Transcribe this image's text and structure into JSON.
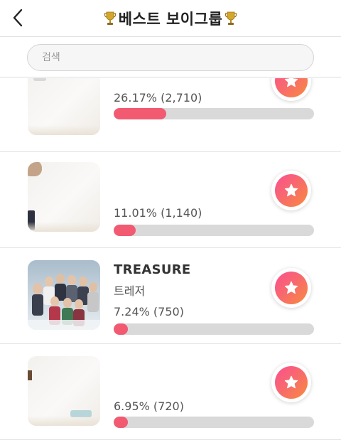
{
  "header": {
    "title": "베스트 보이그룹",
    "back_icon": "chevron-left-icon",
    "trophy_icon": "trophy-icon",
    "trophy_color": "#c89a1f"
  },
  "search": {
    "placeholder": "검색",
    "value": ""
  },
  "theme": {
    "bar_fill": "#f15a71",
    "bar_track": "#d9d9d9",
    "vote_gradient": [
      "#fb4f8f",
      "#f98b3c"
    ]
  },
  "items": [
    {
      "name": "",
      "sub": "",
      "percent_label": "26.17% (2,710)",
      "percent": 26.17,
      "votes": 2710,
      "vote_icon": "star-icon"
    },
    {
      "name": "",
      "sub": "",
      "percent_label": "11.01% (1,140)",
      "percent": 11.01,
      "votes": 1140,
      "vote_icon": "star-icon"
    },
    {
      "name": "TREASURE",
      "sub": "트레저",
      "percent_label": "7.24% (750)",
      "percent": 7.24,
      "votes": 750,
      "vote_icon": "star-icon"
    },
    {
      "name": "",
      "sub": "",
      "percent_label": "6.95% (720)",
      "percent": 6.95,
      "votes": 720,
      "vote_icon": "star-icon"
    }
  ]
}
